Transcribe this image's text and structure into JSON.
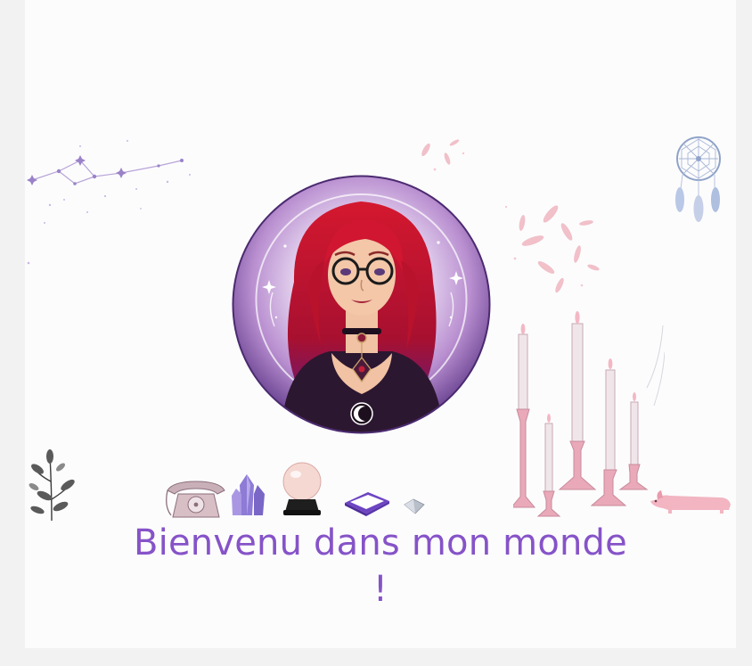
{
  "welcome": {
    "line1": "Bienvenu dans mon monde",
    "line2": "!"
  },
  "colors": {
    "accent": "#8653c8",
    "page_background": "#f2f2f3",
    "card_background": "#fcfcfd",
    "hair": "#c0142b",
    "avatar_ring": "#4b2a70",
    "candle_pink": "#e9a9b9"
  },
  "icons": [
    "constellation-icon",
    "dreamcatcher-icon",
    "feathers-icon",
    "plant-icon",
    "telephone-icon",
    "crystal-icon",
    "crystal-ball-icon",
    "tarot-box-icon",
    "gem-icon",
    "candles-icon",
    "dog-icon"
  ]
}
